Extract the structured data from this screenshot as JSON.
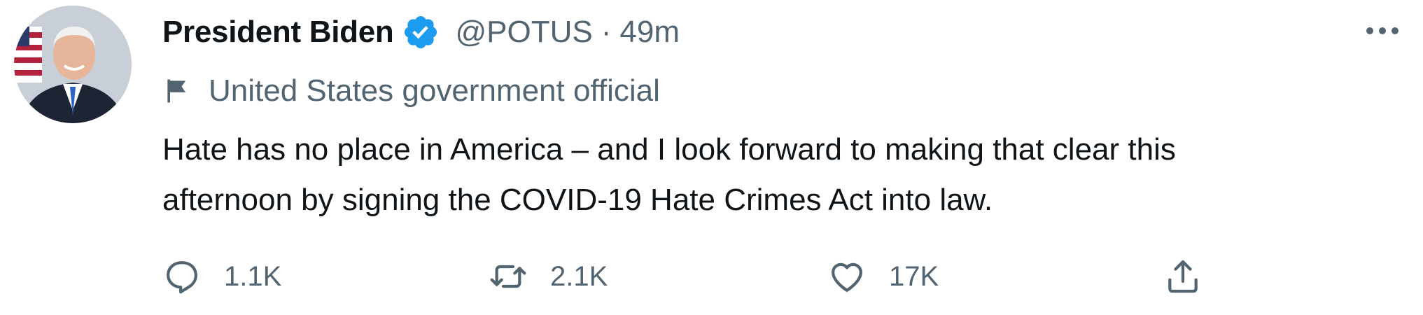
{
  "author": {
    "display_name": "President Biden",
    "handle": "@POTUS",
    "separator": "·",
    "time": "49m",
    "verified": true
  },
  "label": {
    "icon": "flag-icon",
    "text": "United States government official"
  },
  "tweet": {
    "lines": [
      "Hate has no place in America – and I look forward to making that clear this",
      "afternoon by signing the COVID-19 Hate Crimes Act into law."
    ]
  },
  "actions": {
    "reply": {
      "icon": "reply-icon",
      "count": "1.1K"
    },
    "retweet": {
      "icon": "retweet-icon",
      "count": "2.1K"
    },
    "like": {
      "icon": "heart-icon",
      "count": "17K"
    },
    "share": {
      "icon": "share-icon"
    }
  },
  "colors": {
    "text": "#0f1419",
    "secondary": "#536471",
    "verified": "#1d9bf0"
  }
}
